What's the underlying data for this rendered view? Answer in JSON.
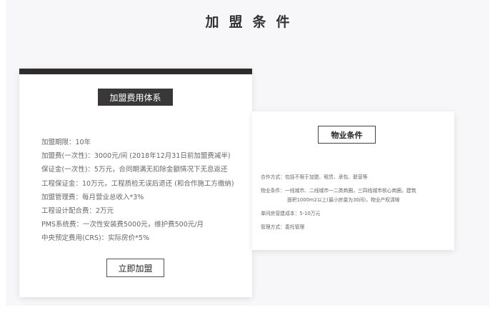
{
  "page": {
    "title": "加盟条件"
  },
  "fee_card": {
    "header_button": "加盟费用体系",
    "items": [
      "加盟期限：10年",
      "加盟费(一次性)：3000元/间 (2018年12月31日前加盟费减半)",
      "保证金(一次性)：5万元，合同期满无扣除金额情况下无息返还",
      "工程保证金：10万元，工程质检无误后退还 (和合作施工方缴纳)",
      "加盟管理费：每月营业总收入*3%",
      "工程设计配合费：2万元",
      "PMS系统费：一次性安装费5000元，维护费500元/月",
      "中央预定费用(CRS)：实际房价*5%"
    ],
    "join_button": "立即加盟"
  },
  "property_card": {
    "header_button": "物业条件",
    "coop_label": "合作方式：",
    "coop_value": "包括不限于加盟、租赁、承包、联营等",
    "property_label": "物业条件：",
    "property_value_line1": "一线城市、二线城市一二类商圈，三四线城市核心商圈，建筑",
    "property_value_line2": "面积1000m2以上(最小房量为30间)，物业产权清晰",
    "cost_label": "单间房营建成本：",
    "cost_value": "5-10万元",
    "mgmt_label": "管理方式：",
    "mgmt_value": "委托管理"
  }
}
